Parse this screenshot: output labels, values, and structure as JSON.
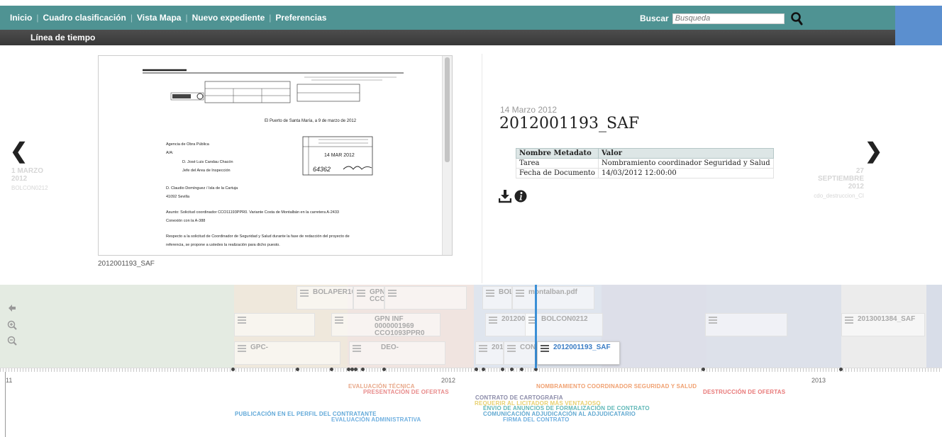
{
  "nav": {
    "items": [
      "Inicio",
      "Cuadro clasificación",
      "Vista Mapa",
      "Nuevo expediente",
      "Preferencias"
    ],
    "separator": "|",
    "search_label": "Buscar",
    "search_placeholder": "Busqueda",
    "subnav_item": "Línea de tiempo"
  },
  "slide": {
    "date": "14 Marzo 2012",
    "title": "2012001193_SAF",
    "doc_caption": "2012001193_SAF",
    "prev": {
      "arrow": "❮",
      "day_month": "1 MARZO",
      "year": "2012",
      "name": "BOLCON0212"
    },
    "next": {
      "arrow": "❯",
      "day": "27",
      "month": "SEPTIEMBRE",
      "year": "2012",
      "name": "cdo_destruccion_CI"
    },
    "meta_headers": [
      "Nombre Metadato",
      "Valor"
    ],
    "meta_rows": [
      [
        "Tarea",
        "Nombramiento coordinador Seguridad y Salud"
      ],
      [
        "Fecha de Documento",
        "14/03/2012 12:00:00"
      ]
    ]
  },
  "document": {
    "place_date": "El Puerto de Santa María, a 9 de marzo de 2012",
    "recipient_org": "Agencia de Obra Pública",
    "recipient_att": "A/A:",
    "recipient_name": "D. José Luis Candau Chacón",
    "recipient_role": "Jefe del Area de Inspección",
    "sender_line": "D. Claudio Domínguez / Isla de la Cartuja",
    "sender_city": "41092 Sevilla",
    "subject": "Asunto: Solicitud coordinador CCO11193PPR0. Variante Costa de Montalbán en la carretera A-2433",
    "subject2": "Conexión con la A-388",
    "body1": "Respecto a la solicitud de Coordinador de Seguridad y Salud durante la fase de redacción del proyecto de",
    "body2": "referencia, se propone a ustedes la realización para dicho puesto.",
    "stamp_date": "14 MAR 2012",
    "stamp_number": "64362"
  },
  "timeline": {
    "events": [
      {
        "label": "BOLAPER101"
      },
      {
        "label": "GPN CCO"
      },
      {
        "label": ""
      },
      {
        "label": "BOL"
      },
      {
        "label": "montalban.pdf"
      },
      {
        "label": ""
      },
      {
        "label": "GPN INF 0000001969 CCO1093PPR0"
      },
      {
        "label": "201200"
      },
      {
        "label": "BOLCON0212"
      },
      {
        "label": ""
      },
      {
        "label": "2013001384_SAF"
      },
      {
        "label": "GPC-"
      },
      {
        "label": "DEO-"
      },
      {
        "label": "201"
      },
      {
        "label": "CON"
      },
      {
        "label": "2012001193_SAF"
      }
    ],
    "years": [
      "11",
      "2012",
      "2013"
    ],
    "phases": [
      {
        "label": "EVALUACIÓN TÉCNICA",
        "color": "#e8a88a"
      },
      {
        "label": "PRESENTACIÓN DE OFERTAS",
        "color": "#e88a8a"
      },
      {
        "label": "NOMBRAMIENTO COORDINADOR SEGURIDAD Y SALUD",
        "color": "#f0a070"
      },
      {
        "label": "DESTRUCCIÓN DE OFERTAS",
        "color": "#e87878"
      },
      {
        "label": "CONTRATO DE CARTOGRAFIA",
        "color": "#8a8aa8"
      },
      {
        "label": "REQUERIR AL LICITADOR MÁS VENTAJOSO",
        "color": "#e8d070"
      },
      {
        "label": "ENVIO DE ANUNCIOS DE FORMALIZACIÓN DE CONTRATO",
        "color": "#60b8b8"
      },
      {
        "label": "COMUNICACIÓN ADJUDICACIÓN AL ADJUDICATARIO",
        "color": "#60a8d0"
      },
      {
        "label": "FIRMA DEL CONTRATO",
        "color": "#70b0e0"
      },
      {
        "label": "PUBLICACIÓN EN EL PERFIL DEL CONTRATANTE",
        "color": "#60a8d8"
      },
      {
        "label": "EVALUACIÓN ADMINISTRATIVA",
        "color": "#70b0e0"
      }
    ]
  }
}
